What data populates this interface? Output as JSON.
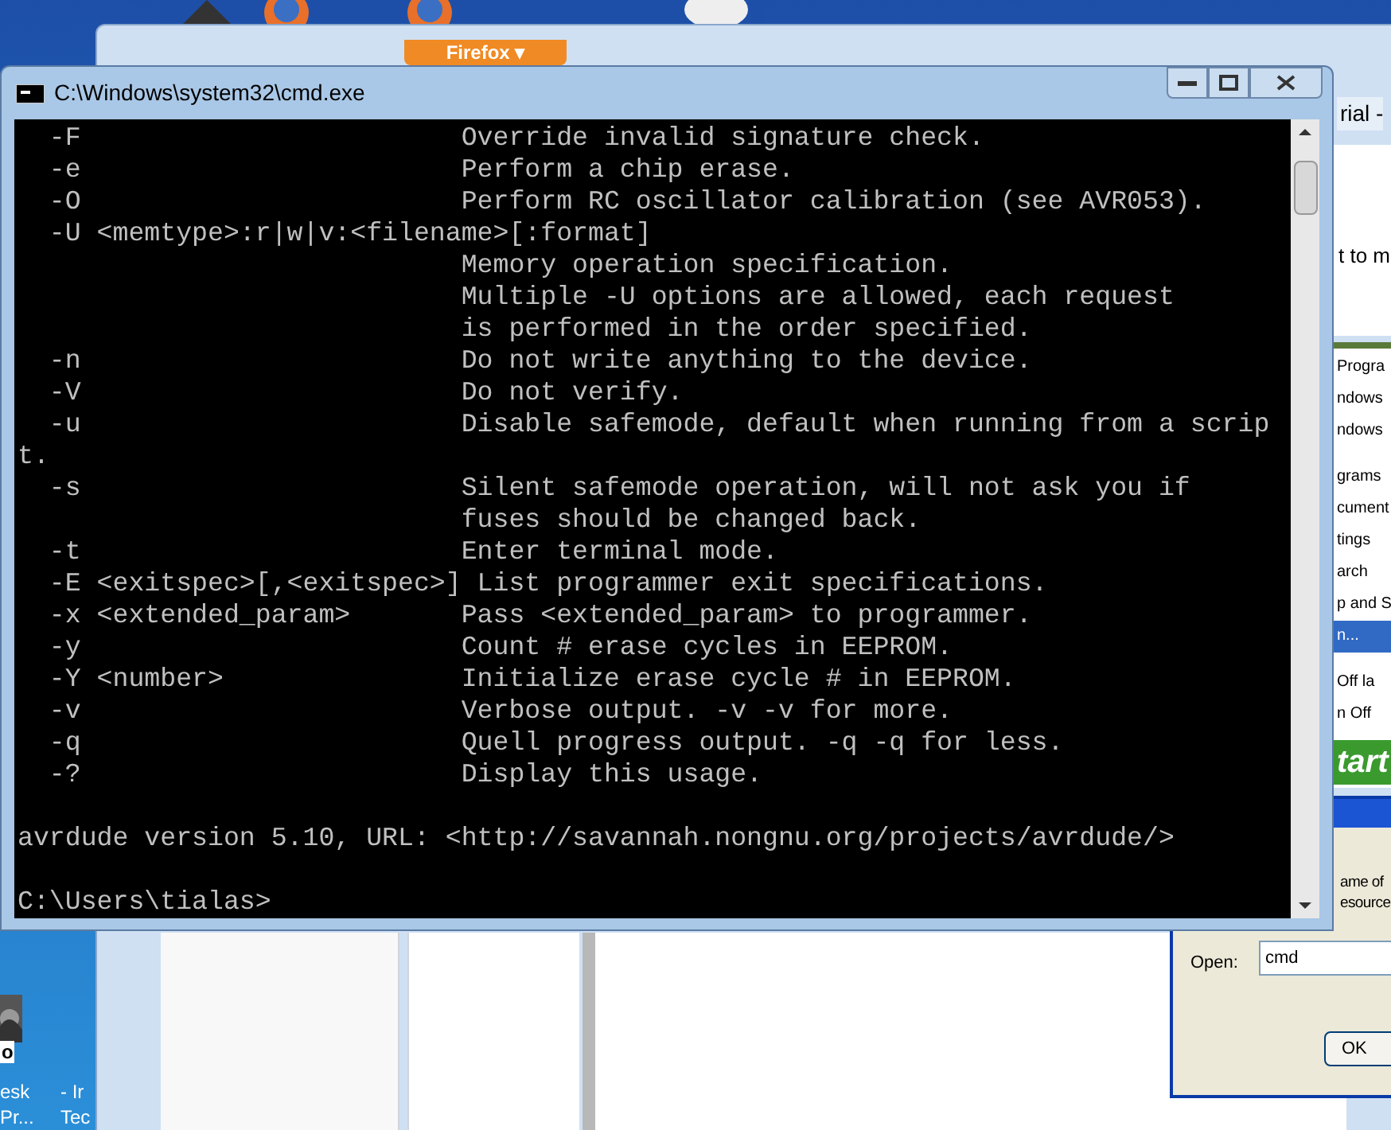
{
  "browser": {
    "menu_button": "Firefox ▾",
    "tab_title": "rial -",
    "page_text": "t to m"
  },
  "start_menu": {
    "items": [
      {
        "label": "Progra",
        "selected": false
      },
      {
        "label": "ndows",
        "selected": false
      },
      {
        "label": "ndows",
        "selected": false
      },
      {
        "label": "grams",
        "selected": false
      },
      {
        "label": "cument",
        "selected": false
      },
      {
        "label": "tings",
        "selected": false
      },
      {
        "label": "arch",
        "selected": false
      },
      {
        "label": "p and S",
        "selected": false
      },
      {
        "label": "n...",
        "selected": true
      },
      {
        "label": "Off la",
        "selected": false
      },
      {
        "label": "n Off",
        "selected": false
      }
    ],
    "banner": "tart"
  },
  "run_dialog": {
    "description": [
      "ame of",
      "esource"
    ],
    "open_label": "Open:",
    "open_value": "cmd",
    "ok": "OK"
  },
  "desktop_icons": [
    {
      "label_lines": [
        "esk",
        "Pr..."
      ]
    },
    {
      "label_lines": [
        "- Ir",
        "Tec"
      ]
    }
  ],
  "desktop_badge": "o",
  "console": {
    "title": "C:\\Windows\\system32\\cmd.exe",
    "lines": [
      "  -F                        Override invalid signature check.",
      "  -e                        Perform a chip erase.",
      "  -O                        Perform RC oscillator calibration (see AVR053).",
      "  -U <memtype>:r|w|v:<filename>[:format]",
      "                            Memory operation specification.",
      "                            Multiple -U options are allowed, each request",
      "                            is performed in the order specified.",
      "  -n                        Do not write anything to the device.",
      "  -V                        Do not verify.",
      "  -u                        Disable safemode, default when running from a scrip",
      "t.",
      "  -s                        Silent safemode operation, will not ask you if",
      "                            fuses should be changed back.",
      "  -t                        Enter terminal mode.",
      "  -E <exitspec>[,<exitspec>] List programmer exit specifications.",
      "  -x <extended_param>       Pass <extended_param> to programmer.",
      "  -y                        Count # erase cycles in EEPROM.",
      "  -Y <number>               Initialize erase cycle # in EEPROM.",
      "  -v                        Verbose output. -v -v for more.",
      "  -q                        Quell progress output. -q -q for less.",
      "  -?                        Display this usage."
    ],
    "version_line": "avrdude version 5.10, URL: <http://savannah.nongnu.org/projects/avrdude/>",
    "prompt": "C:\\Users\\tialas>"
  }
}
